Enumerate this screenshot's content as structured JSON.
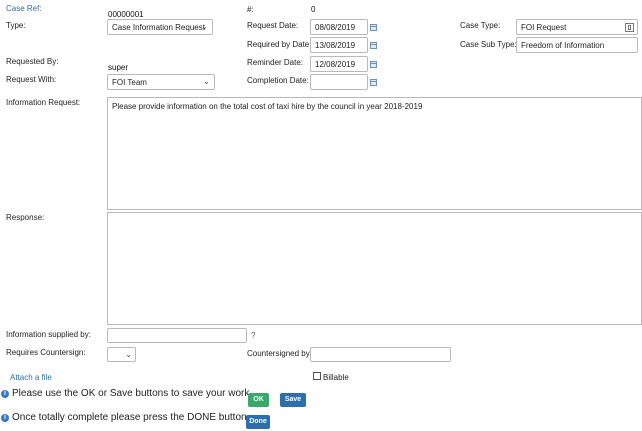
{
  "labels": {
    "case_ref": "Case Ref:",
    "hash": "#:",
    "type": "Type:",
    "request_date": "Request Date:",
    "case_type": "Case Type:",
    "required_by_date": "Required by Date:",
    "case_sub_type": "Case Sub Type:",
    "requested_by": "Requested By:",
    "reminder_date": "Reminder Date:",
    "request_with": "Request With:",
    "completion_date": "Completion Date:",
    "information_request": "Information Request:",
    "response": "Response:",
    "information_supplied_by": "Information supplied by:",
    "requires_countersign": "Requires Countersign:",
    "countersigned_by": "Countersigned by:",
    "attach_file": "Attach a file",
    "billable": "Billable"
  },
  "values": {
    "case_ref": "00000001",
    "hash": "0",
    "type": "Case Information Request",
    "request_date": "08/08/2019",
    "required_by_date": "13/08/2019",
    "reminder_date": "12/08/2019",
    "completion_date": "",
    "case_type": "FOI Request",
    "case_sub_type": "Freedom of Information",
    "requested_by": "super",
    "request_with": "FOI Team",
    "information_request": "Please provide information on the total cost of taxi hire by the council in year 2018-2019",
    "response": "",
    "information_supplied_by": "",
    "requires_countersign": "",
    "countersigned_by": ""
  },
  "messages": {
    "save_hint": "Please use the OK or Save buttons to save your work.",
    "done_hint": "Once totally complete please press the DONE button."
  },
  "buttons": {
    "ok": "OK",
    "save": "Save",
    "done": "Done"
  },
  "icons": {
    "chevron": "chevron-down-icon",
    "calendar": "calendar-icon",
    "info": "info-icon",
    "question": "question-icon",
    "lookup": "lookup-icon"
  },
  "colors": {
    "link": "#2e6da4",
    "ok_button": "#3aa86b",
    "save_button": "#2d6fae",
    "done_button": "#2d6fae",
    "info_icon": "#3a78c3"
  }
}
